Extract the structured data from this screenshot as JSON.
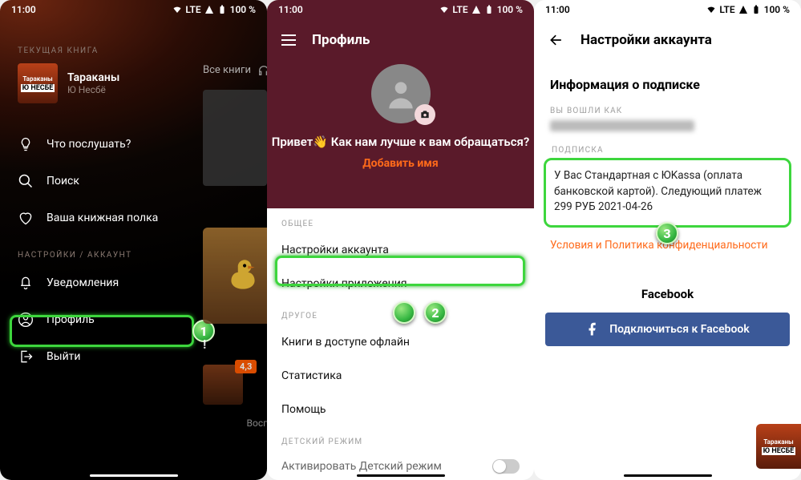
{
  "status": {
    "time": "11:00",
    "net": "LTE",
    "batt": "100 %"
  },
  "screen1": {
    "current_label": "ТЕКУЩАЯ КНИГА",
    "book": {
      "title": "Тараканы",
      "author": "Ю Несбё",
      "cover_top": "Тараканы",
      "cover_bot": "Ю НЕСБЁ"
    },
    "menu": {
      "listen": "Что послушать?",
      "search": "Поиск",
      "shelf": "Ваша книжная полка"
    },
    "settings_label": "НАСТРОЙКИ / АККАУНТ",
    "notifications": "Уведомления",
    "profile": "Профиль",
    "logout": "Выйти",
    "side": {
      "tab": "Все книги",
      "rating": "4,3",
      "excl": "!",
      "playing": "Воспроизв"
    },
    "callout": "1"
  },
  "screen2": {
    "title": "Профиль",
    "greeting": "Привет👋 Как нам лучше к вам обращаться?",
    "add_name": "Добавить имя",
    "sec_general": "ОБЩЕЕ",
    "item_account": "Настройки аккаунта",
    "item_app": "Настройки приложения",
    "sec_other": "ДРУГОЕ",
    "item_offline": "Книги в доступе офлайн",
    "item_stats": "Статистика",
    "item_help": "Помощь",
    "sec_kids": "ДЕТСКИЙ РЕЖИМ",
    "item_kids": "Активировать Детский режим",
    "callout": "2"
  },
  "screen3": {
    "title": "Настройки аккаунта",
    "sub_header": "Информация о подписке",
    "logged_as": "ВЫ ВОШЛИ КАК",
    "sub_label": "ПОДПИСКА",
    "sub_text": "У Вас Стандартная с ЮKassa (оплата банковской картой). Следующий платеж  299 РУБ 2021-04-26",
    "terms": "Условия и Политика конфиденциальности",
    "fb_header": "Facebook",
    "fb_button": "Подключиться к Facebook",
    "mini": {
      "top": "Тараканы",
      "bot": "Ю НЕСБЁ"
    },
    "callout": "3"
  }
}
